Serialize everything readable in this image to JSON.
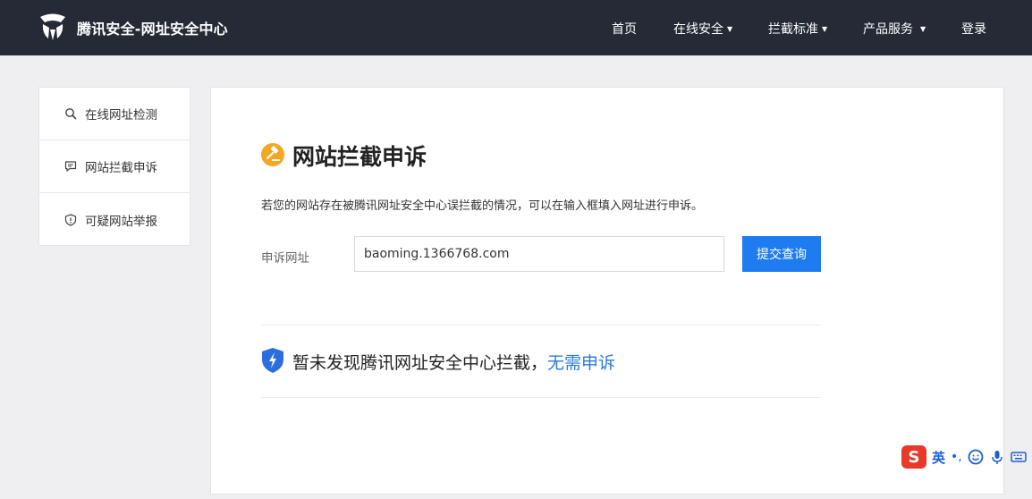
{
  "header": {
    "site_title": "腾讯安全-网址安全中心",
    "nav": [
      {
        "label": "首页",
        "dropdown": false
      },
      {
        "label": "在线安全",
        "dropdown": true
      },
      {
        "label": "拦截标准",
        "dropdown": true
      },
      {
        "label": "产品服务",
        "dropdown": true
      },
      {
        "label": "登录",
        "dropdown": false
      }
    ]
  },
  "sidebar": {
    "items": [
      {
        "label": "在线网址检测",
        "icon": "search-icon"
      },
      {
        "label": "网站拦截申诉",
        "icon": "chat-icon"
      },
      {
        "label": "可疑网站举报",
        "icon": "shield-alert-icon"
      }
    ]
  },
  "main": {
    "title": "网站拦截申诉",
    "description": "若您的网站存在被腾讯网址安全中心误拦截的情况，可以在输入框填入网址进行申诉。",
    "url_label": "申诉网址",
    "url_value": "baoming.1366768.com",
    "submit_label": "提交查询",
    "result_text": "暂未发现腾讯网址安全中心拦截，",
    "result_link": "无需申诉"
  },
  "ime": {
    "logo": "S",
    "mode": "英",
    "punct": "•,"
  },
  "colors": {
    "topbar": "#262a37",
    "accent": "#1e7cf0",
    "title_icon": "#f5a623",
    "shield": "#2a6fdb",
    "link": "#2a7ad9"
  }
}
